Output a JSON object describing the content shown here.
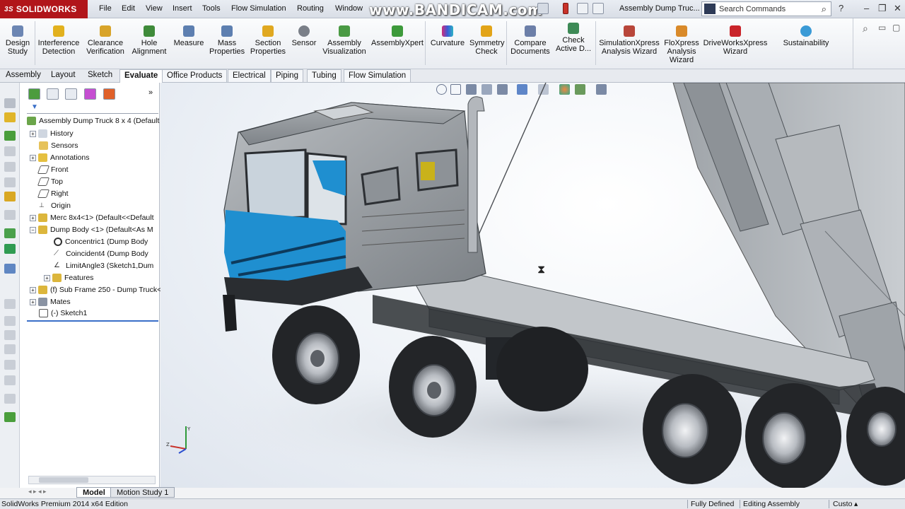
{
  "app": {
    "logo_prefix": "3S",
    "logo_text": "SOLIDWORKS",
    "document_title": "Assembly Dump Truc...",
    "watermark": "www.BANDICAM.com",
    "search_placeholder": "Search Commands"
  },
  "menu": [
    "File",
    "Edit",
    "View",
    "Insert",
    "Tools",
    "Flow Simulation",
    "Routing",
    "Window"
  ],
  "command_manager": {
    "buttons": [
      {
        "label": "Design\nStudy",
        "icon": "design-study-icon"
      },
      {
        "label": "Interference\nDetection",
        "icon": "interference-icon"
      },
      {
        "label": "Clearance\nVerification",
        "icon": "clearance-icon"
      },
      {
        "label": "Hole\nAlignment",
        "icon": "hole-alignment-icon"
      },
      {
        "label": "Measure",
        "icon": "measure-icon"
      },
      {
        "label": "Mass\nProperties",
        "icon": "mass-properties-icon"
      },
      {
        "label": "Section\nProperties",
        "icon": "section-properties-icon"
      },
      {
        "label": "Sensor",
        "icon": "sensor-icon"
      },
      {
        "label": "Assembly\nVisualization",
        "icon": "assembly-visualization-icon"
      },
      {
        "label": "AssemblyXpert",
        "icon": "assemblyxpert-icon"
      },
      {
        "label": "Curvature",
        "icon": "curvature-icon"
      },
      {
        "label": "Symmetry\nCheck",
        "icon": "symmetry-check-icon"
      },
      {
        "label": "Compare\nDocuments",
        "icon": "compare-documents-icon"
      },
      {
        "label": "Check\nActive D...",
        "icon": "check-active-icon"
      },
      {
        "label": "SimulationXpress\nAnalysis Wizard",
        "icon": "simulationxpress-icon"
      },
      {
        "label": "FloXpress\nAnalysis\nWizard",
        "icon": "floxpress-icon"
      },
      {
        "label": "DriveWorksXpress\nWizard",
        "icon": "driveworksxpress-icon"
      },
      {
        "label": "Sustainability",
        "icon": "sustainability-icon"
      }
    ]
  },
  "tabs": [
    "Assembly",
    "Layout",
    "Sketch",
    "Evaluate",
    "Office Products",
    "Electrical",
    "Piping",
    "Tubing",
    "Flow Simulation"
  ],
  "active_tab": "Evaluate",
  "feature_tree": {
    "root": "Assembly Dump Truck 8 x 4  (Default",
    "nodes": [
      {
        "label": "History",
        "expandable": true
      },
      {
        "label": "Sensors",
        "expandable": false
      },
      {
        "label": "Annotations",
        "expandable": true
      },
      {
        "label": "Front",
        "expandable": false
      },
      {
        "label": "Top",
        "expandable": false
      },
      {
        "label": "Right",
        "expandable": false
      },
      {
        "label": "Origin",
        "expandable": false
      },
      {
        "label": "Merc 8x4<1> (Default<<Default",
        "expandable": true
      },
      {
        "label": "Dump Body <1> (Default<As M",
        "expandable": true,
        "expanded": true
      },
      {
        "label": "Concentric1 (Dump Body",
        "child": true
      },
      {
        "label": "Coincident4 (Dump Body",
        "child": true
      },
      {
        "label": "LimitAngle3 (Sketch1,Dum",
        "child": true
      },
      {
        "label": "Features",
        "child": true,
        "expandable": true
      },
      {
        "label": "(f) Sub Frame 250 - Dump Truck<",
        "expandable": true
      },
      {
        "label": "Mates",
        "expandable": true
      },
      {
        "label": "(-) Sketch1",
        "expandable": false
      }
    ]
  },
  "model_tabs": [
    "Model",
    "Motion Study 1"
  ],
  "status_bar": {
    "left": "SolidWorks Premium 2014 x64 Edition",
    "fully_defined": "Fully Defined",
    "editing": "Editing Assembly",
    "custom": "Custo"
  },
  "colors": {
    "brand": "#b1151a",
    "cab_blue": "#1f8fd0",
    "truck_gray": "#8e9398"
  }
}
